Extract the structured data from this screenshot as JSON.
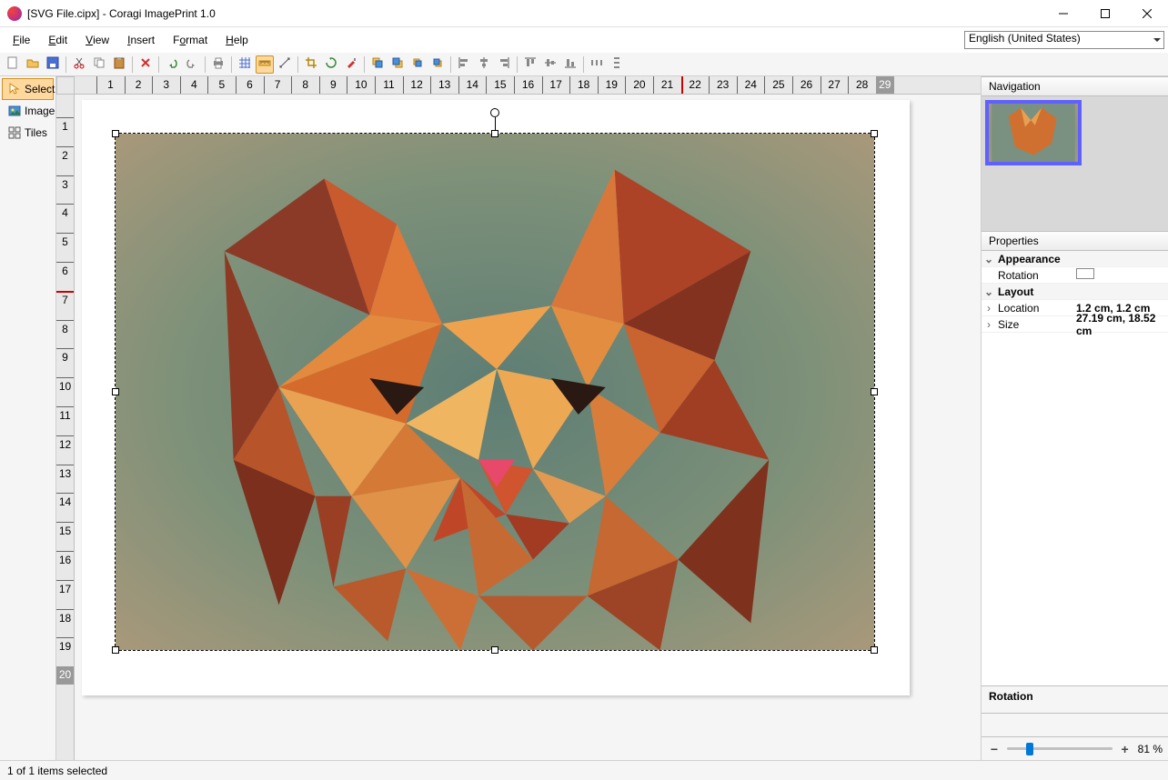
{
  "window": {
    "title": "[SVG File.cipx] - Coragi ImagePrint 1.0"
  },
  "menubar": [
    {
      "label": "File",
      "key": "F"
    },
    {
      "label": "Edit",
      "key": "E"
    },
    {
      "label": "View",
      "key": "V"
    },
    {
      "label": "Insert",
      "key": "I"
    },
    {
      "label": "Format",
      "key": "o",
      "pre": "F",
      "post": "rmat"
    },
    {
      "label": "Help",
      "key": "H"
    }
  ],
  "language": "English (United States)",
  "left_tools": [
    {
      "name": "select",
      "label": "Select",
      "selected": true
    },
    {
      "name": "image",
      "label": "Image",
      "selected": false
    },
    {
      "name": "tiles",
      "label": "Tiles",
      "selected": false
    }
  ],
  "ruler": {
    "h_numbers": [
      "1",
      "2",
      "3",
      "4",
      "5",
      "6",
      "7",
      "8",
      "9",
      "10",
      "11",
      "12",
      "13",
      "14",
      "15",
      "16",
      "17",
      "18",
      "19",
      "20",
      "21",
      "22",
      "23",
      "24",
      "25",
      "26",
      "27",
      "28"
    ],
    "h_end": "29",
    "h_cursor": "22",
    "v_numbers": [
      "1",
      "2",
      "3",
      "4",
      "5",
      "6",
      "7",
      "8",
      "9",
      "10",
      "11",
      "12",
      "13",
      "14",
      "15",
      "16",
      "17",
      "18",
      "19"
    ],
    "v_end": "20",
    "v_cursor": "7"
  },
  "right": {
    "nav_title": "Navigation",
    "props_title": "Properties",
    "groups": [
      {
        "name": "Appearance",
        "rows": [
          {
            "label": "Rotation",
            "value": "",
            "swatch": true
          }
        ]
      },
      {
        "name": "Layout",
        "rows": [
          {
            "label": "Location",
            "value": "1.2 cm, 1.2 cm"
          },
          {
            "label": "Size",
            "value": "27.19 cm, 18.52 cm"
          }
        ]
      }
    ],
    "rotation_label": "Rotation"
  },
  "zoom": {
    "percent": "81 %",
    "position": 18
  },
  "status": "1 of 1 items selected",
  "toolbar_icons": [
    "new-icon",
    "open-icon",
    "save-icon",
    "sep",
    "cut-icon",
    "copy-icon",
    "paste-icon",
    "sep",
    "delete-icon",
    "sep",
    "undo-icon",
    "redo-icon",
    "sep",
    "print-icon",
    "sep",
    "grid-icon",
    "ruler-icon",
    "measure-icon",
    "sep",
    "crop-icon",
    "rotate-icon",
    "brush-icon",
    "sep",
    "bring-front-icon",
    "send-back-icon",
    "forward-icon",
    "backward-icon",
    "sep",
    "align-left-icon",
    "align-center-icon",
    "align-right-icon",
    "sep",
    "align-top-icon",
    "align-middle-icon",
    "align-bottom-icon",
    "sep",
    "distribute-h-icon",
    "distribute-v-icon"
  ]
}
